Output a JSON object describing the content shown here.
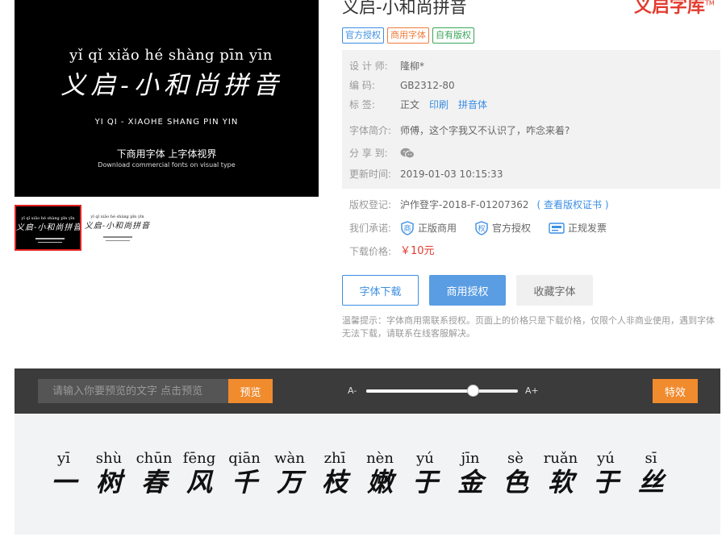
{
  "preview": {
    "pinyin": "yǐ  qǐ  xiǎo hé shàng pīn  yīn",
    "hanzi": "义启-小和尚拼音",
    "latin": "YI QI - XIAOHE SHANG PIN YIN",
    "tagline": "下商用字体  上字体视界",
    "tagline_en": "Download commercial fonts on visual type"
  },
  "thumbnails": [
    {
      "pinyin": "yǐ qǐ xiǎo hé shàng pīn yīn",
      "hanzi": "义启-小和尚拼音",
      "selected": true
    },
    {
      "pinyin": "yǐ qǐ xiǎo hé shàng pīn yīn",
      "hanzi": "义启-小和尚拼音",
      "selected": false
    }
  ],
  "header": {
    "title": "义启-小和尚拼音",
    "brand": "义启字库",
    "brand_mark": "TM"
  },
  "tags": [
    "官方授权",
    "商用字体",
    "自有版权"
  ],
  "info": {
    "designer_label": "设 计 师:",
    "designer": "隆柳*",
    "code_label": "编     码:",
    "code": "GB2312-80",
    "tags_label": "标     签:",
    "tag_values": [
      "正文",
      "印刷",
      "拼音体"
    ],
    "intro_label": "字体简介:",
    "intro": "师傅，这个字我又不认识了，咋念来着?",
    "share_label": "分 享 到:",
    "share_icon": "wechat-icon",
    "updated_label": "更新时间:",
    "updated": "2019-01-03 10:15:33"
  },
  "copyright": {
    "label": "版权登记:",
    "value": "沪作登字-2018-F-01207362",
    "link": "( 查看版权证书 )"
  },
  "promise": {
    "label": "我们承诺:",
    "items": [
      {
        "icon": "shield-shang-icon",
        "text": "正版商用"
      },
      {
        "icon": "shield-quan-icon",
        "text": "官方授权"
      },
      {
        "icon": "invoice-icon",
        "text": "正规发票"
      }
    ]
  },
  "price": {
    "label": "下载价格:",
    "value": "￥10元"
  },
  "buttons": {
    "download": "字体下载",
    "license": "商用授权",
    "favorite": "收藏字体"
  },
  "notice": "温馨提示：字体商用需联系授权。页面上的价格只是下载价格，仅限个人非商业使用，遇到字体无法下载，请联系在线客服解决。",
  "toolbar": {
    "placeholder": "请输入你要预览的文字 点击预览",
    "preview": "预览",
    "size_small": "A-",
    "size_large": "A+",
    "size_level": 0.7,
    "effects": "特效"
  },
  "sample": [
    {
      "pinyin": "yī",
      "hanzi": "一"
    },
    {
      "pinyin": "shù",
      "hanzi": "树"
    },
    {
      "pinyin": "chūn",
      "hanzi": "春"
    },
    {
      "pinyin": "fēng",
      "hanzi": "风"
    },
    {
      "pinyin": "qiān",
      "hanzi": "千"
    },
    {
      "pinyin": "wàn",
      "hanzi": "万"
    },
    {
      "pinyin": "zhī",
      "hanzi": "枝"
    },
    {
      "pinyin": "nèn",
      "hanzi": "嫩"
    },
    {
      "pinyin": "yú",
      "hanzi": "于"
    },
    {
      "pinyin": "jīn",
      "hanzi": "金"
    },
    {
      "pinyin": "sè",
      "hanzi": "色"
    },
    {
      "pinyin": "ruǎn",
      "hanzi": "软"
    },
    {
      "pinyin": "yú",
      "hanzi": "于"
    },
    {
      "pinyin": "sī",
      "hanzi": "丝"
    }
  ],
  "colors": {
    "accent_blue": "#3c8ee3",
    "accent_orange": "#f08b2e",
    "price_red": "#e33b2e",
    "toolbar_bg": "#3b3b3b"
  }
}
